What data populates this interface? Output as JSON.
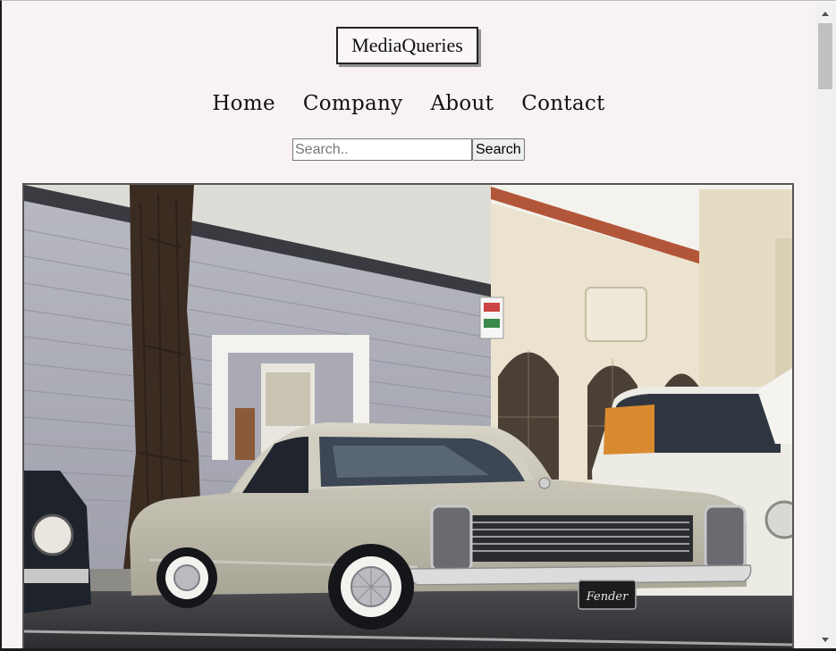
{
  "header": {
    "logo_text": "MediaQueries"
  },
  "nav": {
    "items": [
      {
        "label": "Home"
      },
      {
        "label": "Company"
      },
      {
        "label": "About"
      },
      {
        "label": "Contact"
      }
    ]
  },
  "search": {
    "placeholder": "Search..",
    "value": "",
    "button_label": "Search"
  },
  "hero": {
    "subject": "vintage-cars-parked-on-street",
    "sign_text": "",
    "plate_text": "Fender"
  },
  "colors": {
    "page_background": "#f8f2f2",
    "text": "#111111",
    "logo_border": "#222222",
    "hero_border": "#555555"
  },
  "scroll": {
    "position": 0.0
  }
}
